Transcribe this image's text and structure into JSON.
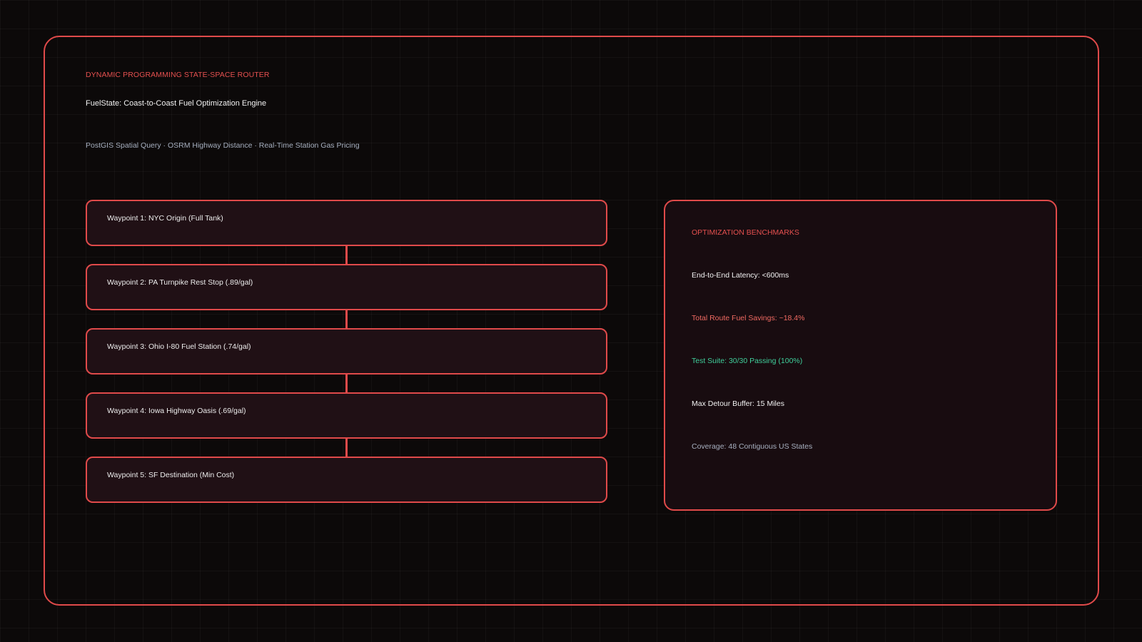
{
  "header": {
    "kicker": "DYNAMIC PROGRAMMING STATE-SPACE ROUTER",
    "title": "FuelState: Coast-to-Coast Fuel Optimization Engine",
    "subtitle": "PostGIS Spatial Query · OSRM Highway Distance · Real-Time Station Gas Pricing"
  },
  "waypoints": [
    {
      "label": "Waypoint 1: NYC Origin (Full Tank)"
    },
    {
      "label": "Waypoint 2: PA Turnpike Rest Stop (.89/gal)"
    },
    {
      "label": "Waypoint 3: Ohio I-80 Fuel Station (.74/gal)"
    },
    {
      "label": "Waypoint 4: Iowa Highway Oasis (.69/gal)"
    },
    {
      "label": "Waypoint 5: SF Destination (Min Cost)"
    }
  ],
  "benchmarks": {
    "title": "OPTIMIZATION BENCHMARKS",
    "items": [
      {
        "text": "End-to-End Latency: <600ms",
        "color": "#f2f2f2"
      },
      {
        "text": "Total Route Fuel Savings: ~18.4%",
        "color": "#f06a62"
      },
      {
        "text": "Test Suite: 30/30 Passing (100%)",
        "color": "#3fcf9b"
      },
      {
        "text": "Max Detour Buffer: 15 Miles",
        "color": "#f2f2f2"
      },
      {
        "text": "Coverage: 48 Contiguous US States",
        "color": "#a7b0c0"
      }
    ]
  },
  "theme": {
    "accent": "#e04a4a",
    "background": "#0c0909",
    "node_fill": "#201015",
    "panel_fill": "#180c10"
  }
}
